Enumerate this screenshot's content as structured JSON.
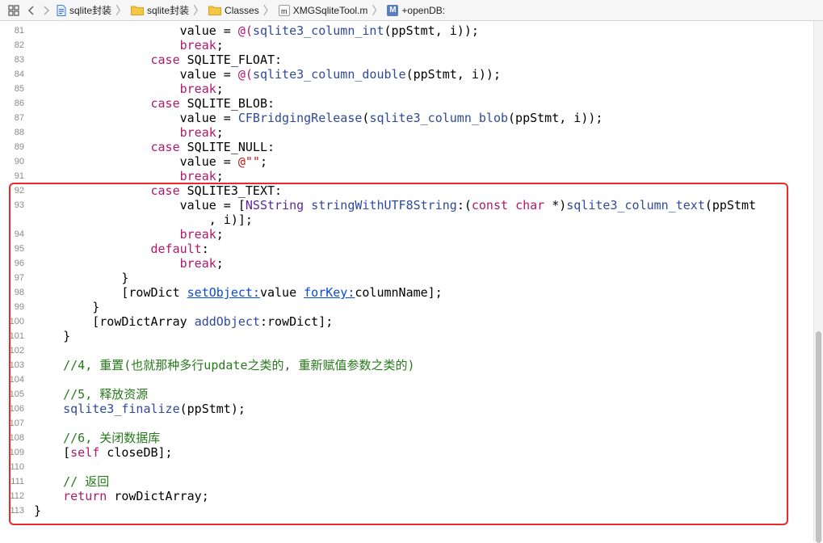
{
  "jump_bar": {
    "grid_icon": "grid-icon",
    "back_icon": "chevron-left-icon",
    "forward_icon": "chevron-right-icon",
    "crumbs": [
      {
        "label": "sqlite封装",
        "icon": "project-file-icon"
      },
      {
        "label": "sqlite封装",
        "icon": "folder-icon"
      },
      {
        "label": "Classes",
        "icon": "folder-icon"
      },
      {
        "label": "XMGSqliteTool.m",
        "icon": "m-file-icon",
        "icon_text": "m"
      },
      {
        "label": "+openDB:",
        "icon": "method-icon",
        "icon_text": "M"
      }
    ]
  },
  "editor": {
    "line_numbers": [
      "81",
      "82",
      "83",
      "84",
      "85",
      "86",
      "87",
      "88",
      "89",
      "90",
      "91",
      "92",
      "93",
      "94",
      "95",
      "96",
      "97",
      "98",
      "99",
      "100",
      "101",
      "102",
      "103",
      "104",
      "105",
      "106",
      "107",
      "108",
      "109",
      "110",
      "111",
      "112",
      "113"
    ],
    "lines": [
      [
        {
          "t": "                    value = "
        },
        {
          "t": "@(",
          "c": "kw"
        },
        {
          "t": "sqlite3_column_int",
          "c": "fn"
        },
        {
          "t": "(ppStmt, i));"
        }
      ],
      [
        {
          "t": "                    "
        },
        {
          "t": "break",
          "c": "kw"
        },
        {
          "t": ";"
        }
      ],
      [
        {
          "t": "                "
        },
        {
          "t": "case",
          "c": "kw"
        },
        {
          "t": " SQLITE_FLOAT:"
        }
      ],
      [
        {
          "t": "                    value = "
        },
        {
          "t": "@(",
          "c": "kw"
        },
        {
          "t": "sqlite3_column_double",
          "c": "fn"
        },
        {
          "t": "(ppStmt, i));"
        }
      ],
      [
        {
          "t": "                    "
        },
        {
          "t": "break",
          "c": "kw"
        },
        {
          "t": ";"
        }
      ],
      [
        {
          "t": "                "
        },
        {
          "t": "case",
          "c": "kw"
        },
        {
          "t": " SQLITE_BLOB:"
        }
      ],
      [
        {
          "t": "                    value = "
        },
        {
          "t": "CFBridgingRelease",
          "c": "fn"
        },
        {
          "t": "("
        },
        {
          "t": "sqlite3_column_blob",
          "c": "fn"
        },
        {
          "t": "(ppStmt, i));"
        }
      ],
      [
        {
          "t": "                    "
        },
        {
          "t": "break",
          "c": "kw"
        },
        {
          "t": ";"
        }
      ],
      [
        {
          "t": "                "
        },
        {
          "t": "case",
          "c": "kw"
        },
        {
          "t": " SQLITE_NULL:"
        }
      ],
      [
        {
          "t": "                    value = "
        },
        {
          "t": "@\"\"",
          "c": "str"
        },
        {
          "t": ";"
        }
      ],
      [
        {
          "t": "                    "
        },
        {
          "t": "break",
          "c": "kw"
        },
        {
          "t": ";"
        }
      ],
      [
        {
          "t": "                "
        },
        {
          "t": "case",
          "c": "kw"
        },
        {
          "t": " SQLITE3_TEXT:"
        }
      ],
      [
        {
          "t": "                    value = ["
        },
        {
          "t": "NSString",
          "c": "mc"
        },
        {
          "t": " "
        },
        {
          "t": "stringWithUTF8String",
          "c": "sel"
        },
        {
          "t": ":("
        },
        {
          "t": "const",
          "c": "kw"
        },
        {
          "t": " "
        },
        {
          "t": "char",
          "c": "kw"
        },
        {
          "t": " *)"
        },
        {
          "t": "sqlite3_column_text",
          "c": "fn"
        },
        {
          "t": "(ppStmt"
        }
      ],
      [
        {
          "t": "                        , i)];"
        }
      ],
      [
        {
          "t": "                    "
        },
        {
          "t": "break",
          "c": "kw"
        },
        {
          "t": ";"
        }
      ],
      [
        {
          "t": "                "
        },
        {
          "t": "default",
          "c": "kw"
        },
        {
          "t": ":"
        }
      ],
      [
        {
          "t": "                    "
        },
        {
          "t": "break",
          "c": "kw"
        },
        {
          "t": ";"
        }
      ],
      [
        {
          "t": "            }"
        }
      ],
      [
        {
          "t": "            [rowDict "
        },
        {
          "t": "setObject:",
          "c": "lk"
        },
        {
          "t": "value "
        },
        {
          "t": "forKey:",
          "c": "lk"
        },
        {
          "t": "columnName];"
        }
      ],
      [
        {
          "t": "        }"
        }
      ],
      [
        {
          "t": "        [rowDictArray "
        },
        {
          "t": "addObject",
          "c": "sel"
        },
        {
          "t": ":rowDict];"
        }
      ],
      [
        {
          "t": "    }"
        }
      ],
      [
        {
          "t": ""
        }
      ],
      [
        {
          "t": "    "
        },
        {
          "t": "//4, 重置(也就那种多行update之类的, 重新赋值参数之类的)",
          "c": "cm"
        }
      ],
      [
        {
          "t": ""
        }
      ],
      [
        {
          "t": "    "
        },
        {
          "t": "//5, 释放资源",
          "c": "cm"
        }
      ],
      [
        {
          "t": "    "
        },
        {
          "t": "sqlite3_finalize",
          "c": "fn"
        },
        {
          "t": "(ppStmt);"
        }
      ],
      [
        {
          "t": ""
        }
      ],
      [
        {
          "t": "    "
        },
        {
          "t": "//6, 关闭数据库",
          "c": "cm"
        }
      ],
      [
        {
          "t": "    ["
        },
        {
          "t": "self",
          "c": "kw"
        },
        {
          "t": " closeDB];"
        }
      ],
      [
        {
          "t": ""
        }
      ],
      [
        {
          "t": "    "
        },
        {
          "t": "// 返回",
          "c": "cm"
        }
      ],
      [
        {
          "t": "    "
        },
        {
          "t": "return",
          "c": "kw"
        },
        {
          "t": " rowDictArray;"
        }
      ],
      [
        {
          "t": "}"
        }
      ]
    ],
    "colors": {
      "keyword": "#b0176b",
      "class": "#5c2699",
      "comment": "#267a1a",
      "string": "#c41a16",
      "function": "#2e4a9a",
      "link": "#0a4bd4",
      "highlight_box": "#ea2a2a"
    }
  }
}
